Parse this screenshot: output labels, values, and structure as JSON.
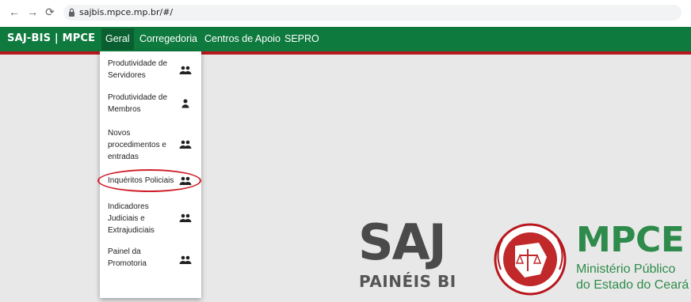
{
  "browser": {
    "url": "sajbis.mpce.mp.br/#/",
    "icons": [
      "back-arrow-icon",
      "forward-arrow-icon",
      "reload-icon",
      "lock-icon"
    ]
  },
  "nav": {
    "brand": "SAJ-BIS | MPCE",
    "items": [
      {
        "label": "Geral",
        "active": true
      },
      {
        "label": "Corregedoria",
        "active": false
      },
      {
        "label": "Centros de Apoio",
        "active": false
      },
      {
        "label": "SEPRO",
        "active": false
      }
    ],
    "colors": {
      "bar": "#0e7a3e",
      "active": "#0a5f30",
      "accent": "#b8171d"
    }
  },
  "dropdown": {
    "items": [
      {
        "lines": [
          "Produtividade de",
          "Servidores"
        ],
        "icon": "users-icon"
      },
      {
        "lines": [
          "Produtividade de",
          "Membros"
        ],
        "icon": "user-icon"
      },
      {
        "lines": [
          "Novos",
          "procedimentos e",
          "entradas"
        ],
        "icon": "users-icon"
      },
      {
        "lines": [
          "Inquéritos Policiais"
        ],
        "icon": "users-icon",
        "highlighted": true
      },
      {
        "lines": [
          "Indicadores",
          "Judiciais e",
          "Extrajudiciais"
        ],
        "icon": "users-icon"
      },
      {
        "lines": [
          "Painel da",
          "Promotoria"
        ],
        "icon": "users-icon"
      }
    ]
  },
  "logos": {
    "saj": {
      "letters": "SAJ",
      "subtitle": "PAINÉIS BI"
    },
    "mpce": {
      "name": "MPCE",
      "line1": "Ministério Público",
      "line2": "do Estado do Ceará",
      "color": "#2e8b4b"
    }
  }
}
